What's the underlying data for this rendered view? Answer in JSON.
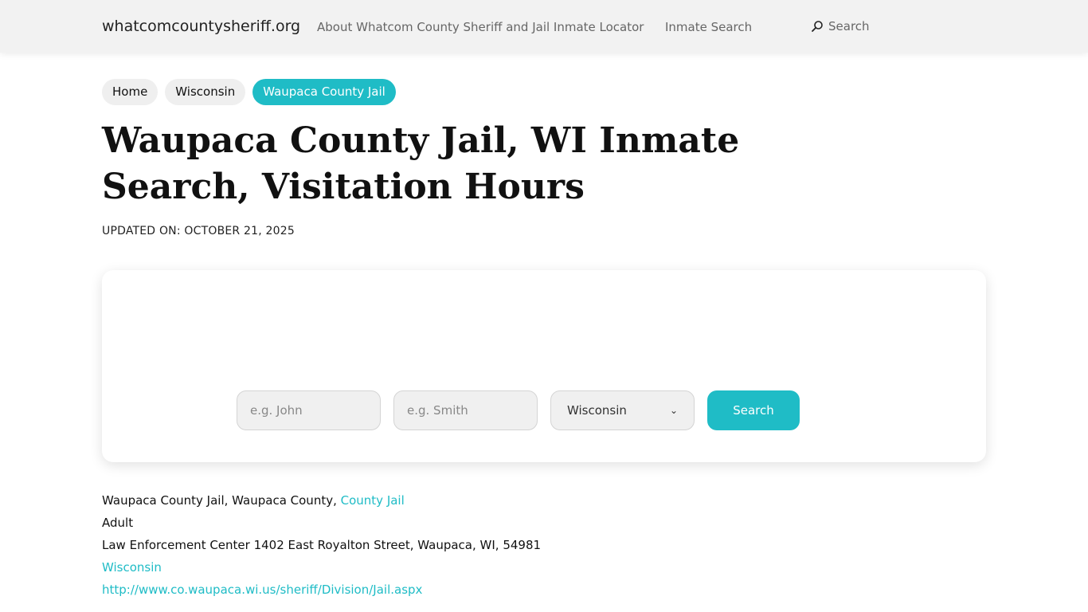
{
  "header": {
    "brand": "whatcomcountysheriff.org",
    "nav_about": "About Whatcom County Sheriff and Jail Inmate Locator",
    "nav_inmate": "Inmate Search",
    "nav_search": "Search"
  },
  "breadcrumb": [
    "Home",
    "Wisconsin",
    "Waupaca County Jail"
  ],
  "page": {
    "title": "Waupaca County Jail, WI Inmate Search, Visitation Hours",
    "updated": "UPDATED ON: OCTOBER 21, 2025"
  },
  "search_form": {
    "first_placeholder": "e.g. John",
    "last_placeholder": "e.g. Smith",
    "state_selected": "Wisconsin",
    "button": "Search"
  },
  "info": {
    "line1_text": "Waupaca County Jail, Waupaca County, ",
    "line1_link": "County Jail",
    "line2": "Adult",
    "line3": "Law Enforcement Center 1402 East Royalton Street, Waupaca, WI, 54981",
    "line4_link": "Wisconsin",
    "line5_link": "http://www.co.waupaca.wi.us/sheriff/Division/Jail.aspx"
  },
  "colors": {
    "accent": "#1fbcc6",
    "header_bg": "#f2f2f2"
  }
}
